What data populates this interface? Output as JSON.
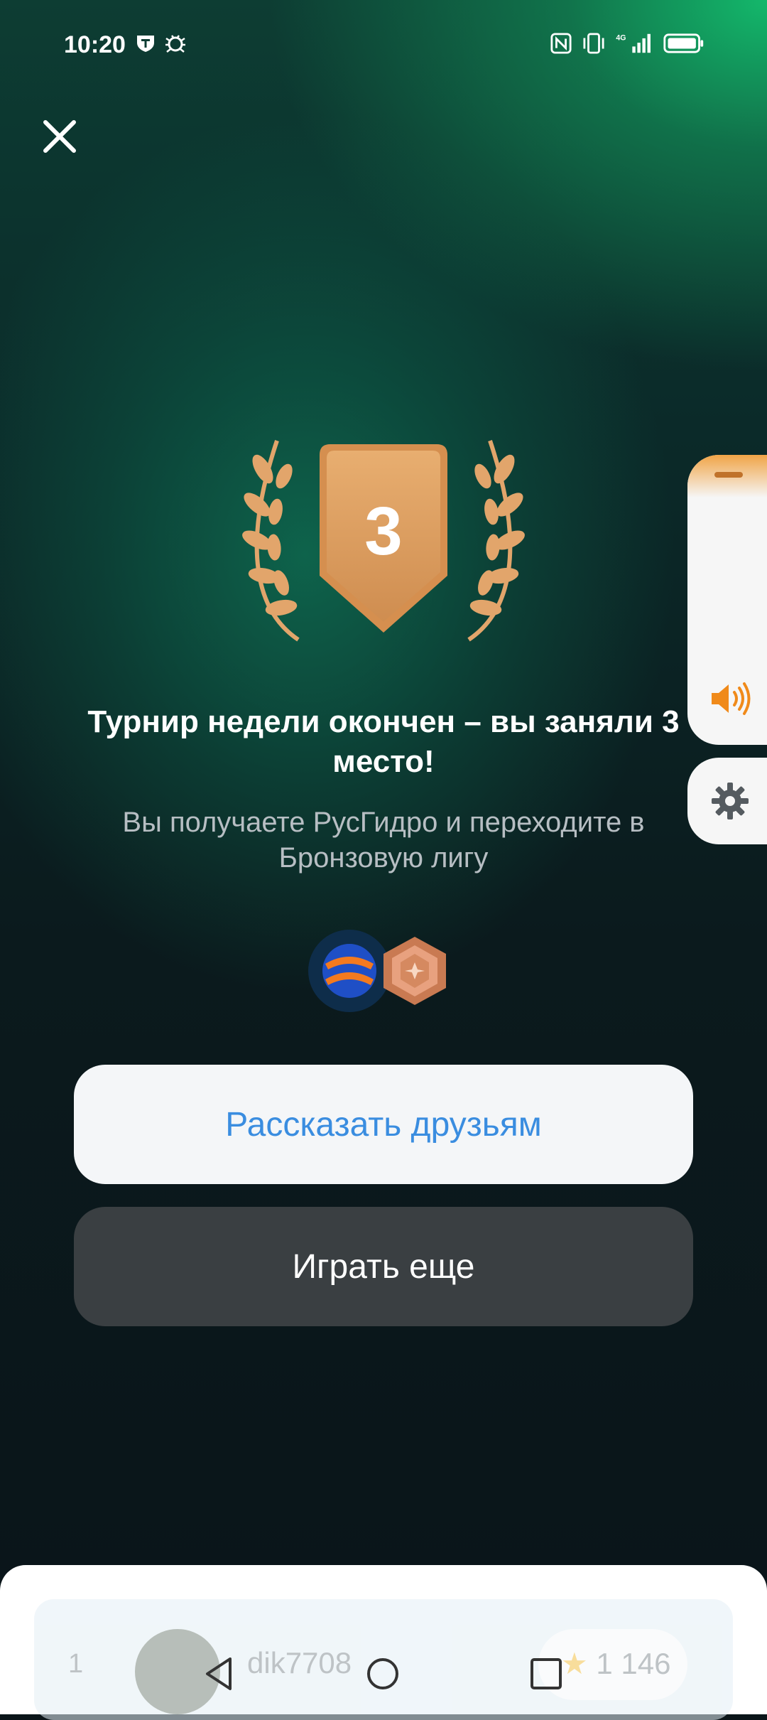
{
  "status_bar": {
    "time": "10:20",
    "icons": [
      "shield-t-icon",
      "bug-icon",
      "nfc-icon",
      "vibrate-icon",
      "signal-4g-icon",
      "battery-icon"
    ]
  },
  "close": {
    "icon": "close-icon"
  },
  "result": {
    "place": "3",
    "title": "Турнир недели окончен – вы заняли 3 место!",
    "subtitle": "Вы получаете РусГидро и переходите в Бронзовую лигу",
    "rewards": [
      "rushydro-logo-icon",
      "bronze-league-badge-icon"
    ]
  },
  "buttons": {
    "share_label": "Рассказать друзьям",
    "play_again_label": "Играть еще"
  },
  "side_panel": {
    "volume_icon": "speaker-icon",
    "settings_icon": "gear-icon"
  },
  "leaderboard_preview": {
    "rank": "1",
    "username": "dik7708",
    "score": "1 146"
  },
  "colors": {
    "accent_bronze": "#E2A56B",
    "share_text": "#3A8DE0",
    "play_button_bg": "#3A3F42",
    "volume_orange": "#F08A1A"
  },
  "nav_bar": [
    "back-icon",
    "home-icon",
    "recents-icon"
  ]
}
